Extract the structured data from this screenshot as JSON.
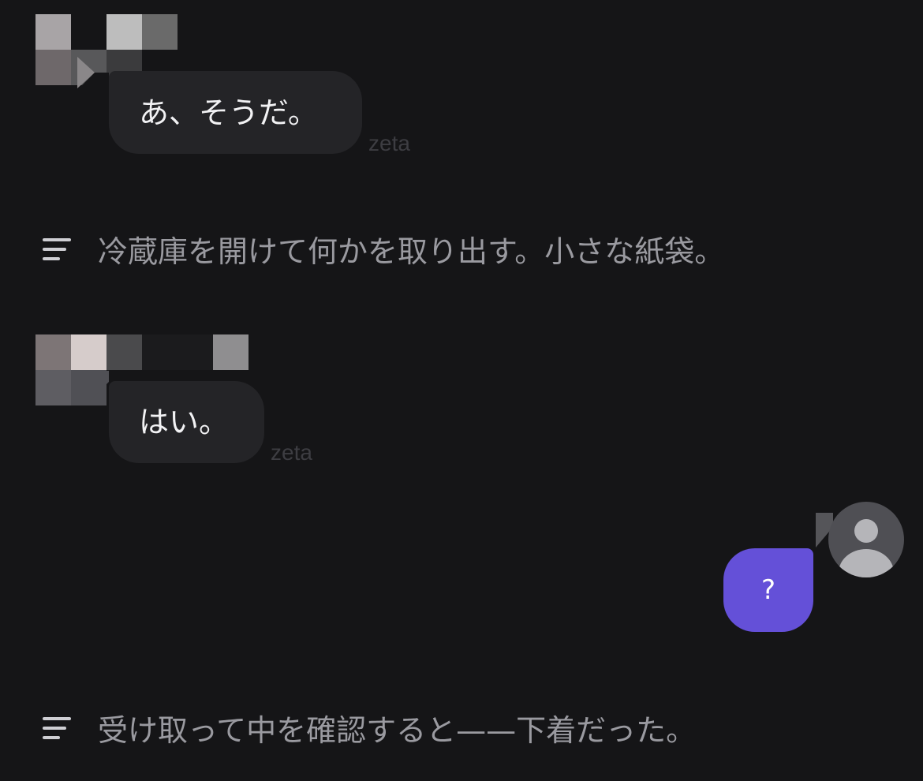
{
  "messages": [
    {
      "type": "character",
      "text": "あ、そうだ。",
      "tag": "zeta"
    },
    {
      "type": "narration",
      "text": "冷蔵庫を開けて何かを取り出す。小さな紙袋。",
      "icon": "lines-icon"
    },
    {
      "type": "character",
      "text": "はい。",
      "tag": "zeta"
    },
    {
      "type": "user",
      "text": "?",
      "avatar": "default-user-avatar-icon"
    },
    {
      "type": "narration",
      "text": "受け取って中を確認すると——下着だった。",
      "icon": "lines-icon"
    }
  ],
  "colors": {
    "background": "#151517",
    "character_bubble": "#242427",
    "user_bubble": "#6450d8",
    "narration_text": "#9a9aa0"
  }
}
